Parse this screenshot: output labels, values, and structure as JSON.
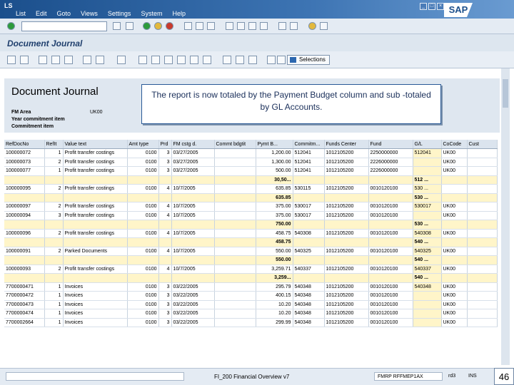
{
  "titlebar": {
    "app_mark": "LS",
    "menu": [
      "List",
      "Edit",
      "Goto",
      "Views",
      "Settings",
      "System",
      "Help"
    ],
    "logo": "SAP"
  },
  "page": {
    "title": "Document Journal"
  },
  "toolbar2": {
    "selections_label": "Selections"
  },
  "report": {
    "title": "Document Journal",
    "fm_area_label": "FM Area",
    "fm_area_value": "UK00",
    "year_commitment_label": "Year commitment item",
    "commitment_item_label": "Commitment item"
  },
  "callout": {
    "text": "The report is now totaled by the Payment Budget column and sub -totaled by GL Accounts."
  },
  "grid": {
    "columns": [
      "RefDocNo",
      "RefIt",
      "Value text",
      "Amt type",
      "Prd",
      "FM cstg d.",
      "Commt bdgtit",
      "Pymt B...",
      "Commitm...",
      "Funds Center",
      "Fund",
      "G/L",
      "CoCode",
      "Cust"
    ],
    "rows": [
      {
        "type": "data",
        "cells": [
          "100000072",
          "1",
          "Profit transfer costings",
          "0100",
          "3",
          "03/27/2005",
          "",
          "1,200.00",
          "512041",
          "1012105200",
          "2250000000",
          "512041",
          "UK00",
          ""
        ]
      },
      {
        "type": "data",
        "cells": [
          "100000073",
          "2",
          "Profit transfer costings",
          "0100",
          "3",
          "03/27/2005",
          "",
          "1,300.00",
          "512041",
          "1012105200",
          "2226000000",
          "",
          "UK00",
          ""
        ]
      },
      {
        "type": "data",
        "cells": [
          "100000077",
          "1",
          "Profit transfer costings",
          "0100",
          "3",
          "03/27/2005",
          "",
          "500.00",
          "512041",
          "1012105200",
          "2226000000",
          "",
          "UK00",
          ""
        ]
      },
      {
        "type": "sub",
        "cells": [
          "",
          "",
          "",
          "",
          "",
          "",
          "",
          "30,50...",
          "",
          "",
          "",
          "512 ...",
          "",
          ""
        ]
      },
      {
        "type": "data",
        "cells": [
          "100000095",
          "2",
          "Profit transfer costings",
          "0100",
          "4",
          "10/7/2005",
          "",
          "635.85",
          "530115",
          "1012105200",
          "0010120100",
          "530 ...",
          "",
          ""
        ]
      },
      {
        "type": "sub",
        "cells": [
          "",
          "",
          "",
          "",
          "",
          "",
          "",
          "635.85",
          "",
          "",
          "",
          "530 ...",
          "",
          ""
        ]
      },
      {
        "type": "data",
        "cells": [
          "100000097",
          "2",
          "Profit transfer costings",
          "0100",
          "4",
          "10/7/2005",
          "",
          "375.00",
          "530017",
          "1012105200",
          "0010120100",
          "530017",
          "UK00",
          ""
        ]
      },
      {
        "type": "data",
        "cells": [
          "100000094",
          "3",
          "Profit transfer costings",
          "0100",
          "4",
          "10/7/2005",
          "",
          "375.00",
          "530017",
          "1012105200",
          "0010120100",
          "",
          "UK00",
          ""
        ]
      },
      {
        "type": "sub",
        "cells": [
          "",
          "",
          "",
          "",
          "",
          "",
          "",
          "750.00",
          "",
          "",
          "",
          "530 ...",
          "",
          ""
        ]
      },
      {
        "type": "data",
        "cells": [
          "100000096",
          "2",
          "Profit transfer costings",
          "0100",
          "4",
          "10/7/2005",
          "",
          "458.75",
          "540308",
          "1012105200",
          "0010120100",
          "540308",
          "UK00",
          ""
        ]
      },
      {
        "type": "sub",
        "cells": [
          "",
          "",
          "",
          "",
          "",
          "",
          "",
          "458.75",
          "",
          "",
          "",
          "540 ...",
          "",
          ""
        ]
      },
      {
        "type": "data",
        "cells": [
          "100000091",
          "2",
          "Parked Documents",
          "0100",
          "4",
          "10/7/2005",
          "",
          "550.00",
          "540325",
          "1012105200",
          "0010120100",
          "540325",
          "UK00",
          ""
        ]
      },
      {
        "type": "sub",
        "cells": [
          "",
          "",
          "",
          "",
          "",
          "",
          "",
          "550.00",
          "",
          "",
          "",
          "540 ...",
          "",
          ""
        ]
      },
      {
        "type": "data",
        "cells": [
          "100000093",
          "2",
          "Profit transfer costings",
          "0100",
          "4",
          "10/7/2005",
          "",
          "3,259.71",
          "540337",
          "1012105200",
          "0010120100",
          "540337",
          "UK00",
          ""
        ]
      },
      {
        "type": "sub",
        "cells": [
          "",
          "",
          "",
          "",
          "",
          "",
          "",
          "3,259...",
          "",
          "",
          "",
          "540 ...",
          "",
          ""
        ]
      },
      {
        "type": "data",
        "cells": [
          "7700000471",
          "1",
          "Invoices",
          "0100",
          "3",
          "03/22/2005",
          "",
          "295.79",
          "540348",
          "1012105200",
          "0010120100",
          "540348",
          "UK00",
          ""
        ]
      },
      {
        "type": "data",
        "cells": [
          "7700000472",
          "1",
          "Invoices",
          "0100",
          "3",
          "03/22/2005",
          "",
          "400.15",
          "540348",
          "1012105200",
          "0010120100",
          "",
          "UK00",
          ""
        ]
      },
      {
        "type": "data",
        "cells": [
          "7700000473",
          "1",
          "Invoices",
          "0100",
          "3",
          "03/22/2005",
          "",
          "10.20",
          "540348",
          "1012105200",
          "0010120100",
          "",
          "UK00",
          ""
        ]
      },
      {
        "type": "data",
        "cells": [
          "7700000474",
          "1",
          "Invoices",
          "0100",
          "3",
          "03/22/2005",
          "",
          "10.20",
          "540348",
          "1012105200",
          "0010120100",
          "",
          "UK00",
          ""
        ]
      },
      {
        "type": "data",
        "cells": [
          "7700002664",
          "1",
          "Invoices",
          "0100",
          "3",
          "03/22/2005",
          "",
          "299.99",
          "540348",
          "1012105200",
          "0010120100",
          "",
          "UK00",
          ""
        ]
      }
    ]
  },
  "statusbar": {
    "center_text": "FI_200 Financial Overview v7",
    "system": "FMRP  RFFMEP1AX",
    "host": "rd3",
    "mode": "INS",
    "page_number": "46"
  }
}
